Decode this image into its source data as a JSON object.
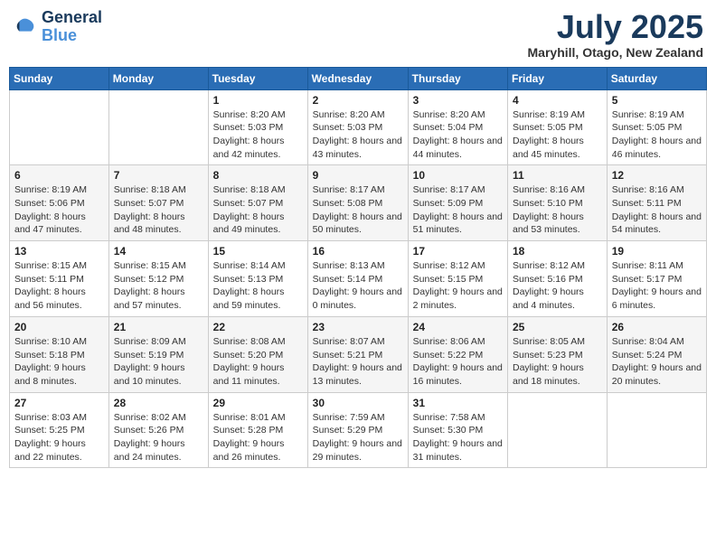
{
  "logo": {
    "line1": "General",
    "line2": "Blue"
  },
  "title": "July 2025",
  "location": "Maryhill, Otago, New Zealand",
  "weekdays": [
    "Sunday",
    "Monday",
    "Tuesday",
    "Wednesday",
    "Thursday",
    "Friday",
    "Saturday"
  ],
  "weeks": [
    [
      {
        "day": "",
        "info": ""
      },
      {
        "day": "",
        "info": ""
      },
      {
        "day": "1",
        "info": "Sunrise: 8:20 AM\nSunset: 5:03 PM\nDaylight: 8 hours and 42 minutes."
      },
      {
        "day": "2",
        "info": "Sunrise: 8:20 AM\nSunset: 5:03 PM\nDaylight: 8 hours and 43 minutes."
      },
      {
        "day": "3",
        "info": "Sunrise: 8:20 AM\nSunset: 5:04 PM\nDaylight: 8 hours and 44 minutes."
      },
      {
        "day": "4",
        "info": "Sunrise: 8:19 AM\nSunset: 5:05 PM\nDaylight: 8 hours and 45 minutes."
      },
      {
        "day": "5",
        "info": "Sunrise: 8:19 AM\nSunset: 5:05 PM\nDaylight: 8 hours and 46 minutes."
      }
    ],
    [
      {
        "day": "6",
        "info": "Sunrise: 8:19 AM\nSunset: 5:06 PM\nDaylight: 8 hours and 47 minutes."
      },
      {
        "day": "7",
        "info": "Sunrise: 8:18 AM\nSunset: 5:07 PM\nDaylight: 8 hours and 48 minutes."
      },
      {
        "day": "8",
        "info": "Sunrise: 8:18 AM\nSunset: 5:07 PM\nDaylight: 8 hours and 49 minutes."
      },
      {
        "day": "9",
        "info": "Sunrise: 8:17 AM\nSunset: 5:08 PM\nDaylight: 8 hours and 50 minutes."
      },
      {
        "day": "10",
        "info": "Sunrise: 8:17 AM\nSunset: 5:09 PM\nDaylight: 8 hours and 51 minutes."
      },
      {
        "day": "11",
        "info": "Sunrise: 8:16 AM\nSunset: 5:10 PM\nDaylight: 8 hours and 53 minutes."
      },
      {
        "day": "12",
        "info": "Sunrise: 8:16 AM\nSunset: 5:11 PM\nDaylight: 8 hours and 54 minutes."
      }
    ],
    [
      {
        "day": "13",
        "info": "Sunrise: 8:15 AM\nSunset: 5:11 PM\nDaylight: 8 hours and 56 minutes."
      },
      {
        "day": "14",
        "info": "Sunrise: 8:15 AM\nSunset: 5:12 PM\nDaylight: 8 hours and 57 minutes."
      },
      {
        "day": "15",
        "info": "Sunrise: 8:14 AM\nSunset: 5:13 PM\nDaylight: 8 hours and 59 minutes."
      },
      {
        "day": "16",
        "info": "Sunrise: 8:13 AM\nSunset: 5:14 PM\nDaylight: 9 hours and 0 minutes."
      },
      {
        "day": "17",
        "info": "Sunrise: 8:12 AM\nSunset: 5:15 PM\nDaylight: 9 hours and 2 minutes."
      },
      {
        "day": "18",
        "info": "Sunrise: 8:12 AM\nSunset: 5:16 PM\nDaylight: 9 hours and 4 minutes."
      },
      {
        "day": "19",
        "info": "Sunrise: 8:11 AM\nSunset: 5:17 PM\nDaylight: 9 hours and 6 minutes."
      }
    ],
    [
      {
        "day": "20",
        "info": "Sunrise: 8:10 AM\nSunset: 5:18 PM\nDaylight: 9 hours and 8 minutes."
      },
      {
        "day": "21",
        "info": "Sunrise: 8:09 AM\nSunset: 5:19 PM\nDaylight: 9 hours and 10 minutes."
      },
      {
        "day": "22",
        "info": "Sunrise: 8:08 AM\nSunset: 5:20 PM\nDaylight: 9 hours and 11 minutes."
      },
      {
        "day": "23",
        "info": "Sunrise: 8:07 AM\nSunset: 5:21 PM\nDaylight: 9 hours and 13 minutes."
      },
      {
        "day": "24",
        "info": "Sunrise: 8:06 AM\nSunset: 5:22 PM\nDaylight: 9 hours and 16 minutes."
      },
      {
        "day": "25",
        "info": "Sunrise: 8:05 AM\nSunset: 5:23 PM\nDaylight: 9 hours and 18 minutes."
      },
      {
        "day": "26",
        "info": "Sunrise: 8:04 AM\nSunset: 5:24 PM\nDaylight: 9 hours and 20 minutes."
      }
    ],
    [
      {
        "day": "27",
        "info": "Sunrise: 8:03 AM\nSunset: 5:25 PM\nDaylight: 9 hours and 22 minutes."
      },
      {
        "day": "28",
        "info": "Sunrise: 8:02 AM\nSunset: 5:26 PM\nDaylight: 9 hours and 24 minutes."
      },
      {
        "day": "29",
        "info": "Sunrise: 8:01 AM\nSunset: 5:28 PM\nDaylight: 9 hours and 26 minutes."
      },
      {
        "day": "30",
        "info": "Sunrise: 7:59 AM\nSunset: 5:29 PM\nDaylight: 9 hours and 29 minutes."
      },
      {
        "day": "31",
        "info": "Sunrise: 7:58 AM\nSunset: 5:30 PM\nDaylight: 9 hours and 31 minutes."
      },
      {
        "day": "",
        "info": ""
      },
      {
        "day": "",
        "info": ""
      }
    ]
  ]
}
